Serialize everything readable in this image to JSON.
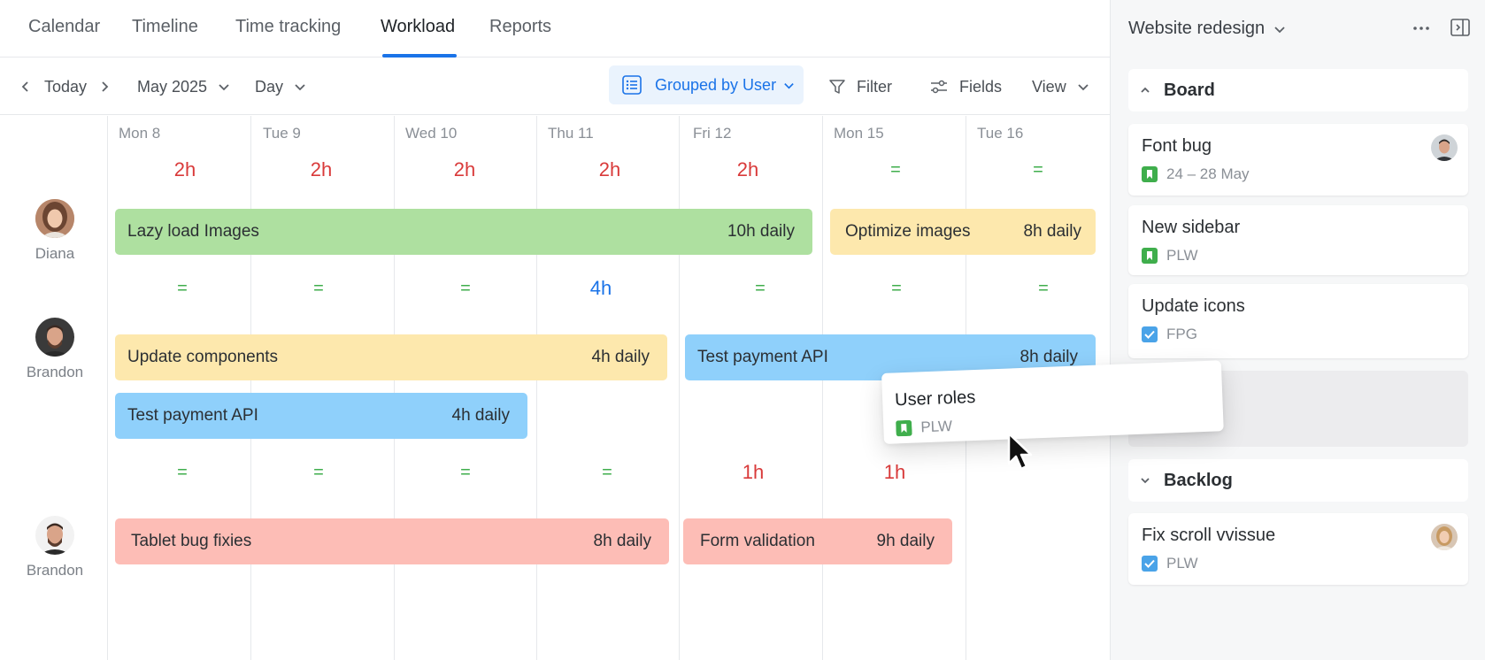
{
  "tabs": [
    {
      "label": "Calendar"
    },
    {
      "label": "Timeline"
    },
    {
      "label": "Time tracking"
    },
    {
      "label": "Workload",
      "active": true
    },
    {
      "label": "Reports"
    }
  ],
  "toolbar": {
    "today_label": "Today",
    "month_label": "May 2025",
    "scale_label": "Day",
    "grouped_label": "Grouped by User",
    "filter_label": "Filter",
    "fields_label": "Fields",
    "view_label": "View"
  },
  "days": [
    "Mon 8",
    "Tue 9",
    "Wed 10",
    "Thu 11",
    "Fri 12",
    "Mon 15",
    "Tue 16"
  ],
  "rows": [
    {
      "user": "Diana",
      "hours": [
        {
          "text": "2h",
          "status": "red"
        },
        {
          "text": "2h",
          "status": "red"
        },
        {
          "text": "2h",
          "status": "red"
        },
        {
          "text": "2h",
          "status": "red"
        },
        {
          "text": "2h",
          "status": "red"
        },
        {
          "text": "=",
          "status": "green"
        },
        {
          "text": "=",
          "status": "green"
        }
      ],
      "tasks": [
        {
          "name": "Lazy load Images",
          "rate": "10h daily",
          "color": "green"
        },
        {
          "name": "Optimize images",
          "rate": "8h daily",
          "color": "yellow"
        }
      ]
    },
    {
      "user": "Brandon",
      "hours": [
        {
          "text": "=",
          "status": "green"
        },
        {
          "text": "=",
          "status": "green"
        },
        {
          "text": "=",
          "status": "green"
        },
        {
          "text": "4h",
          "status": "blue"
        },
        {
          "text": "=",
          "status": "green"
        },
        {
          "text": "=",
          "status": "green"
        },
        {
          "text": "=",
          "status": "green"
        }
      ],
      "tasks": [
        {
          "name": "Update components",
          "rate": "4h daily",
          "color": "yellow"
        },
        {
          "name": "Test payment API",
          "rate": "8h daily",
          "color": "blue"
        },
        {
          "name": "Test payment API",
          "rate": "4h daily",
          "color": "blue"
        }
      ]
    },
    {
      "user": "Brandon",
      "hours": [
        {
          "text": "=",
          "status": "green"
        },
        {
          "text": "=",
          "status": "green"
        },
        {
          "text": "=",
          "status": "green"
        },
        {
          "text": "=",
          "status": "green"
        },
        {
          "text": "1h",
          "status": "red"
        },
        {
          "text": "1h",
          "status": "red"
        }
      ],
      "tasks": [
        {
          "name": "Tablet bug fixies",
          "rate": "8h daily",
          "color": "red"
        },
        {
          "name": "Form validation",
          "rate": "9h daily",
          "color": "red"
        }
      ]
    }
  ],
  "dragging_card": {
    "title": "User roles",
    "tag": "PLW",
    "tag_icon": "bookmark-icon"
  },
  "panel": {
    "project": "Website redesign",
    "sections": [
      {
        "label": "Board",
        "expanded": true,
        "cards": [
          {
            "title": "Font bug",
            "meta": "24 – 28 May",
            "icon": "bookmark-icon",
            "has_avatar": true
          },
          {
            "title": "New sidebar",
            "meta": "PLW",
            "icon": "bookmark-icon",
            "has_avatar": false
          },
          {
            "title": "Update icons",
            "meta": "FPG",
            "icon": "checkbox-icon",
            "has_avatar": false
          }
        ]
      },
      {
        "label": "Backlog",
        "expanded": false,
        "cards": [
          {
            "title": "Fix scroll vvissue",
            "meta": "PLW",
            "icon": "checkbox-icon",
            "has_avatar": true
          }
        ]
      }
    ]
  },
  "colors": {
    "accent": "#1a73e8",
    "over": "#d93a3a",
    "ok": "#3fae4c",
    "bar_green": "#aee0a0",
    "bar_yellow": "#fde8ad",
    "bar_blue": "#8fd0fb",
    "bar_red": "#fdbdb6"
  }
}
